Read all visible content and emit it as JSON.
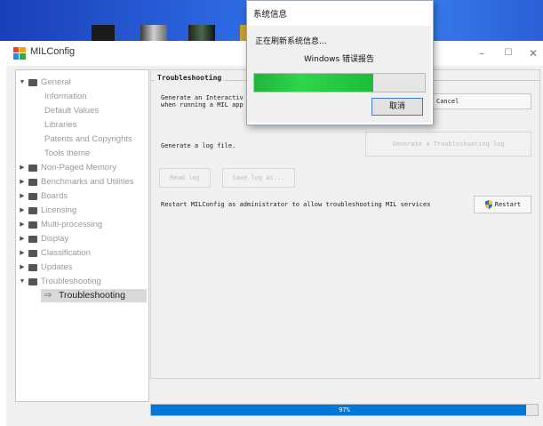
{
  "window": {
    "title": "MILConfig",
    "minimize_glyph": "–",
    "maximize_glyph": "☐",
    "close_glyph": "✕"
  },
  "tree": {
    "items": [
      {
        "label": "General",
        "twisty": "▼",
        "folder": true
      },
      {
        "label": "Information"
      },
      {
        "label": "Default Values"
      },
      {
        "label": "Libraries"
      },
      {
        "label": "Patents and Copyrights"
      },
      {
        "label": "Tools theme"
      },
      {
        "label": "Non-Paged Memory",
        "twisty": "▶",
        "folder": true
      },
      {
        "label": "Benchmarks and Utilities",
        "twisty": "▶",
        "folder": true
      },
      {
        "label": "Boards",
        "twisty": "▶",
        "folder": true
      },
      {
        "label": "Licensing",
        "twisty": "▶",
        "folder": true
      },
      {
        "label": "Multi-processing",
        "twisty": "▶",
        "folder": true
      },
      {
        "label": "Display",
        "twisty": "▶",
        "folder": true
      },
      {
        "label": "Classification",
        "twisty": "▶",
        "folder": true
      },
      {
        "label": "Updates",
        "twisty": "▶",
        "folder": true
      },
      {
        "label": "Troubleshooting",
        "twisty": "▼",
        "folder": true
      },
      {
        "label": "Troubleshooting",
        "selected": true
      }
    ]
  },
  "troubleshooting": {
    "group_title": "Troubleshooting",
    "interactive_line1": "Generate an Interactiv",
    "interactive_line2": "when running a MIL app",
    "cancel_label": "Cancel",
    "log_text": "Generate a log file.",
    "generate_log_label": "Generate a Troubleshooting log",
    "read_log_label": "Read log",
    "save_log_label": "Save log As...",
    "restart_text": "Restart MILConfig as administrator to allow troubleshooting MIL services",
    "restart_label": "Restart"
  },
  "progress": {
    "label": "97%",
    "fraction": 0.97
  },
  "dialog": {
    "title": "系统信息",
    "status": "正在刷新系统信息...",
    "subtitle": "Windows 错误报告",
    "cancel_label": "取消",
    "progress_fraction": 0.7
  },
  "colors": {
    "accent": "#0078d7",
    "dialog_progress": "#2ed64a"
  }
}
